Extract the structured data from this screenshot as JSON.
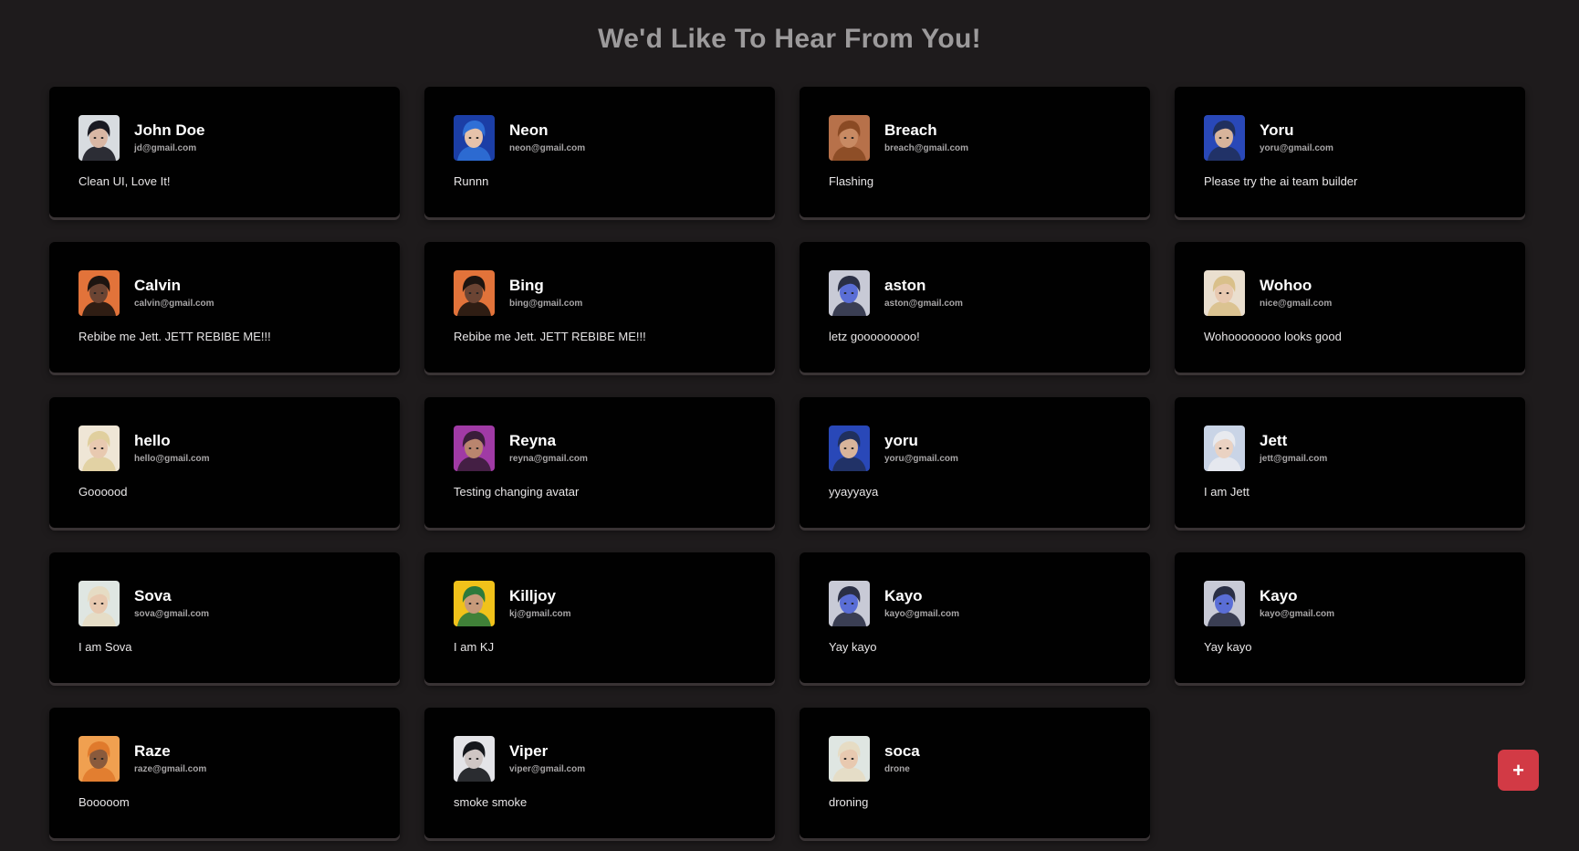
{
  "header": {
    "title": "We'd Like To Hear From You!"
  },
  "colors": {
    "accent": "#d23a45",
    "background": "#1e1b1c",
    "card": "#010101"
  },
  "fab": {
    "label": "+",
    "icon": "plus-icon"
  },
  "feedback": [
    {
      "name": "John Doe",
      "email": "jd@gmail.com",
      "message": "Clean UI, Love It!",
      "avatar": "jett-avatar-icon",
      "skin": "#d9b7a4",
      "hair": "#1a1a22",
      "bg": "#d8dce0"
    },
    {
      "name": "Neon",
      "email": "neon@gmail.com",
      "message": "Runnn",
      "avatar": "neon-avatar-icon",
      "skin": "#e6c2aa",
      "hair": "#2f6fd6",
      "bg": "#1b3ea6"
    },
    {
      "name": "Breach",
      "email": "breach@gmail.com",
      "message": "Flashing",
      "avatar": "breach-avatar-icon",
      "skin": "#c88a63",
      "hair": "#8a4a24",
      "bg": "#b7714a"
    },
    {
      "name": "Yoru",
      "email": "yoru@gmail.com",
      "message": "Please try the ai team builder",
      "avatar": "yoru-avatar-icon",
      "skin": "#d8b49b",
      "hair": "#20305e",
      "bg": "#2948b8"
    },
    {
      "name": "Calvin",
      "email": "calvin@gmail.com",
      "message": "Rebibe me Jett. JETT REBIBE ME!!!",
      "avatar": "phoenix-avatar-icon",
      "skin": "#6b4433",
      "hair": "#1c1410",
      "bg": "#e2733a"
    },
    {
      "name": "Bing",
      "email": "bing@gmail.com",
      "message": "Rebibe me Jett. JETT REBIBE ME!!!",
      "avatar": "phoenix-avatar-icon",
      "skin": "#6b4433",
      "hair": "#1c1410",
      "bg": "#e2733a"
    },
    {
      "name": "aston",
      "email": "aston@gmail.com",
      "message": "letz gooooooooo!",
      "avatar": "kayo-avatar-icon",
      "skin": "#5a6ed6",
      "hair": "#2a2f45",
      "bg": "#c8cad6"
    },
    {
      "name": "Wohoo",
      "email": "nice@gmail.com",
      "message": "Wohoooooooo looks good",
      "avatar": "sova-avatar-icon",
      "skin": "#e8c9b0",
      "hair": "#d9c08a",
      "bg": "#eadfcf"
    },
    {
      "name": "hello",
      "email": "hello@gmail.com",
      "message": "Goooood",
      "avatar": "sova-avatar-icon",
      "skin": "#e8c9b0",
      "hair": "#e0cf9e",
      "bg": "#efe6d6"
    },
    {
      "name": "Reyna",
      "email": "reyna@gmail.com",
      "message": "Testing changing avatar",
      "avatar": "reyna-avatar-icon",
      "skin": "#b9856e",
      "hair": "#3a1d3a",
      "bg": "#a03aa5"
    },
    {
      "name": "yoru",
      "email": "yoru@gmail.com",
      "message": "yyayyaya",
      "avatar": "yoru-avatar-icon",
      "skin": "#d8b49b",
      "hair": "#20305e",
      "bg": "#2948b8"
    },
    {
      "name": "Jett",
      "email": "jett@gmail.com",
      "message": "I am Jett",
      "avatar": "jett-avatar-icon",
      "skin": "#ead2c2",
      "hair": "#e8eaef",
      "bg": "#c9d4e6"
    },
    {
      "name": "Sova",
      "email": "sova@gmail.com",
      "message": "I am Sova",
      "avatar": "sova-avatar-icon",
      "skin": "#e8c9b0",
      "hair": "#e6dcc4",
      "bg": "#dfe6e2"
    },
    {
      "name": "Killjoy",
      "email": "kj@gmail.com",
      "message": "I am KJ",
      "avatar": "killjoy-avatar-icon",
      "skin": "#c79a7a",
      "hair": "#2c7a3c",
      "bg": "#f1c21a"
    },
    {
      "name": "Kayo",
      "email": "kayo@gmail.com",
      "message": "Yay kayo",
      "avatar": "kayo-avatar-icon",
      "skin": "#5a6ed6",
      "hair": "#2a2f45",
      "bg": "#c8cad6"
    },
    {
      "name": "Kayo",
      "email": "kayo@gmail.com",
      "message": "Yay kayo",
      "avatar": "kayo-avatar-icon",
      "skin": "#5a6ed6",
      "hair": "#2a2f45",
      "bg": "#c8cad6"
    },
    {
      "name": "Raze",
      "email": "raze@gmail.com",
      "message": "Booooom",
      "avatar": "raze-avatar-icon",
      "skin": "#8a5a3c",
      "hair": "#e07a2c",
      "bg": "#f0a050"
    },
    {
      "name": "Viper",
      "email": "viper@gmail.com",
      "message": "smoke smoke",
      "avatar": "viper-avatar-icon",
      "skin": "#cfc6c4",
      "hair": "#15171c",
      "bg": "#e4e4e8"
    },
    {
      "name": "soca",
      "email": "drone",
      "message": "droning",
      "avatar": "sova-avatar-icon",
      "skin": "#e8c9b0",
      "hair": "#e6dcc4",
      "bg": "#dfe6e2"
    }
  ]
}
